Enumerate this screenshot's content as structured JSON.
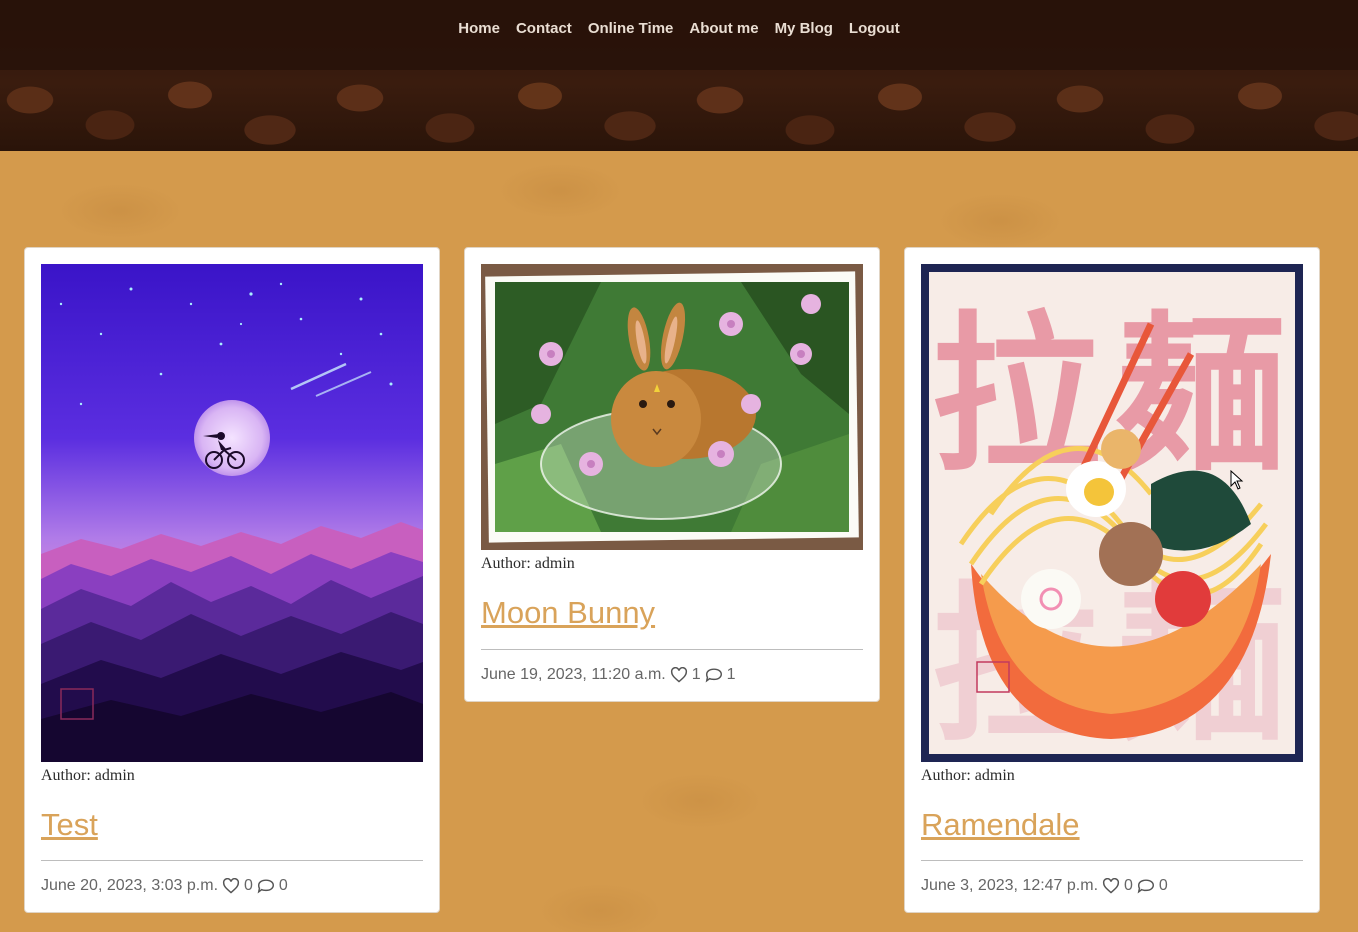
{
  "nav": {
    "items": [
      "Home",
      "Contact",
      "Online Time",
      "About me",
      "My Blog",
      "Logout"
    ]
  },
  "posts": [
    {
      "image": "night-sky-moon-cyclist-painting",
      "author_label": "Author:",
      "author": "admin",
      "title": "Test",
      "date": "June 20, 2023, 3:03 p.m.",
      "likes": "0",
      "comments": "0"
    },
    {
      "image": "bunny-in-glass-bowl-watercolor",
      "author_label": "Author:",
      "author": "admin",
      "title": "Moon Bunny",
      "date": "June 19, 2023, 11:20 a.m.",
      "likes": "1",
      "comments": "1"
    },
    {
      "image": "ramen-bowl-illustration",
      "author_label": "Author:",
      "author": "admin",
      "title": "Ramendale",
      "date": "June 3, 2023, 12:47 p.m.",
      "likes": "0",
      "comments": "0",
      "poster_text": [
        "拉",
        "麺"
      ]
    }
  ],
  "colors": {
    "page_bg": "#d49a4c",
    "navbar_bg": "#2a1209",
    "title_link": "#d9a35a",
    "card_bg": "#ffffff"
  },
  "icons": {
    "like": "heart-icon",
    "comment": "comment-icon"
  }
}
